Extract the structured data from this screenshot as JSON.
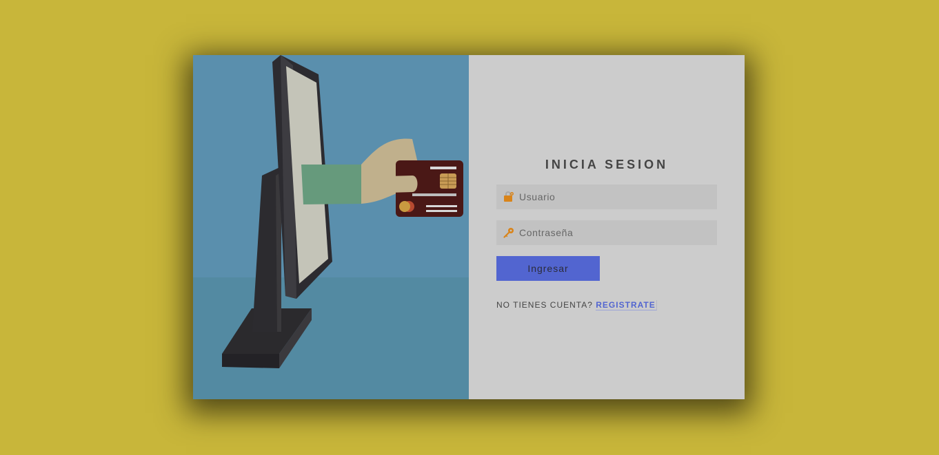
{
  "login": {
    "title": "INICIA SESION",
    "username_placeholder": "Usuario",
    "password_placeholder": "Contraseña",
    "submit_label": "Ingresar",
    "signup_prompt": "NO TIENES CUENTA?",
    "signup_link": "REGISTRATE"
  },
  "icons": {
    "username": "lock-icon",
    "password": "key-icon",
    "illustration": "online-payment-illustration"
  },
  "colors": {
    "page_background": "#c8b63a",
    "illustration_background": "#5a8fad",
    "panel_background": "#cccccc",
    "field_background": "#c2c2c2",
    "accent": "#5265d0",
    "icon_accent": "#d9841a"
  }
}
